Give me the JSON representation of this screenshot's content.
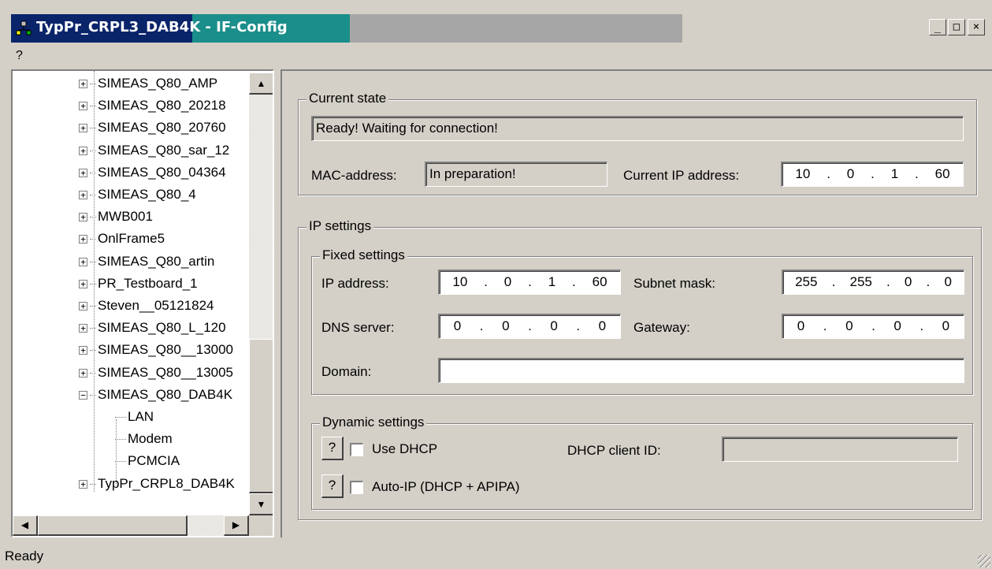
{
  "window": {
    "title": "TypPr_CRPL3_DAB4K - IF-Config",
    "caption_buttons": {
      "minimize": "_",
      "maximize": "□",
      "close": "×"
    }
  },
  "menu": {
    "help": "?"
  },
  "tree": {
    "items": [
      {
        "label": "SIMEAS_Q80_AMP",
        "expander": "+"
      },
      {
        "label": "SIMEAS_Q80_20218",
        "expander": "+"
      },
      {
        "label": "SIMEAS_Q80_20760",
        "expander": "+"
      },
      {
        "label": "SIMEAS_Q80_sar_12",
        "expander": "+"
      },
      {
        "label": "SIMEAS_Q80_04364",
        "expander": "+"
      },
      {
        "label": "SIMEAS_Q80_4",
        "expander": "+"
      },
      {
        "label": "MWB001",
        "expander": "+"
      },
      {
        "label": "OnlFrame5",
        "expander": "+"
      },
      {
        "label": "SIMEAS_Q80_artin",
        "expander": "+"
      },
      {
        "label": "PR_Testboard_1",
        "expander": "+"
      },
      {
        "label": "Steven__05121824",
        "expander": "+"
      },
      {
        "label": "SIMEAS_Q80_L_120",
        "expander": "+"
      },
      {
        "label": "SIMEAS_Q80__13000",
        "expander": "+"
      },
      {
        "label": "SIMEAS_Q80__13005",
        "expander": "+"
      },
      {
        "label": "SIMEAS_Q80_DAB4K",
        "expander": "−"
      }
    ],
    "children": [
      "LAN",
      "Modem",
      "PCMCIA"
    ],
    "last_item": {
      "label": "TypPr_CRPL8_DAB4K",
      "expander": "+"
    }
  },
  "current_state": {
    "legend": "Current state",
    "status": "Ready! Waiting for connection!",
    "mac_label": "MAC-address:",
    "mac_value": "In preparation!",
    "current_ip_label": "Current IP address:",
    "current_ip": [
      "10",
      "0",
      "1",
      "60"
    ]
  },
  "ip_settings": {
    "legend": "IP settings",
    "fixed": {
      "legend": "Fixed settings",
      "ip_label": "IP address:",
      "ip": [
        "10",
        "0",
        "1",
        "60"
      ],
      "subnet_label": "Subnet mask:",
      "subnet": [
        "255",
        "255",
        "0",
        "0"
      ],
      "dns_label": "DNS server:",
      "dns": [
        "0",
        "0",
        "0",
        "0"
      ],
      "gateway_label": "Gateway:",
      "gateway": [
        "0",
        "0",
        "0",
        "0"
      ],
      "domain_label": "Domain:",
      "domain_value": ""
    },
    "dynamic": {
      "legend": "Dynamic settings",
      "help_btn": "?",
      "use_dhcp": "Use DHCP",
      "use_dhcp_checked": false,
      "client_id_label": "DHCP client ID:",
      "client_id_value": "",
      "auto_ip": "Auto-IP (DHCP + APIPA)",
      "auto_ip_checked": false
    }
  },
  "status_bar": {
    "text": "Ready"
  }
}
